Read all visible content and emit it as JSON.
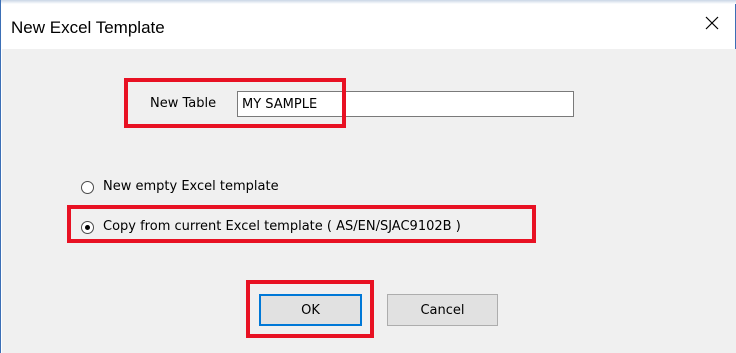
{
  "dialog": {
    "title": "New Excel Template",
    "close_icon": "close-icon"
  },
  "new_table": {
    "label": "New Table",
    "value": "MY SAMPLE"
  },
  "options": [
    {
      "label": "New empty Excel template",
      "selected": false
    },
    {
      "label": "Copy from current Excel template ( AS/EN/SJAC9102B )",
      "selected": true
    }
  ],
  "buttons": {
    "ok_label": "OK",
    "cancel_label": "Cancel"
  },
  "colors": {
    "highlight": "#e81123",
    "window_border": "#3b6fb6",
    "client_background": "#f0f0f0",
    "default_button_border": "#0078d7"
  }
}
